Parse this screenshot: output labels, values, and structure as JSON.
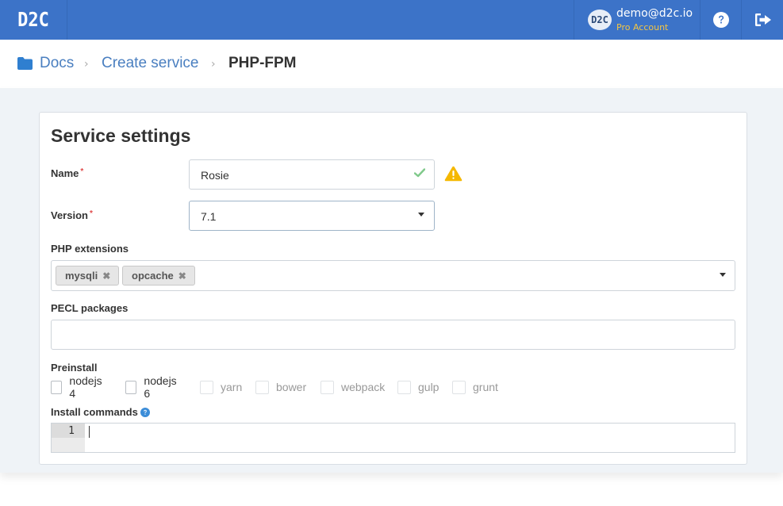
{
  "app": {
    "logo_text": "D2C",
    "account": {
      "avatar_text": "D2C",
      "email": "demo@d2c.io",
      "plan": "Pro Account"
    },
    "icons": {
      "help": "question-circle-icon",
      "logout": "sign-out-icon"
    }
  },
  "breadcrumb": {
    "items": [
      "Docs",
      "Create service"
    ],
    "current": "PHP-FPM",
    "separator": "›"
  },
  "form": {
    "title": "Service settings",
    "name": {
      "label": "Name",
      "required_mark": "*",
      "value": "Rosie"
    },
    "version": {
      "label": "Version",
      "required_mark": "*",
      "selected": "7.1"
    },
    "php_extensions": {
      "label": "PHP extensions",
      "tags": [
        "mysqli",
        "opcache"
      ],
      "remove_mark": "✖"
    },
    "pecl_packages": {
      "label": "PECL packages",
      "value": ""
    },
    "preinstall": {
      "label": "Preinstall",
      "options": [
        {
          "label": "nodejs 4",
          "checked": false,
          "enabled": true
        },
        {
          "label": "nodejs 6",
          "checked": false,
          "enabled": true
        },
        {
          "label": "yarn",
          "checked": false,
          "enabled": false
        },
        {
          "label": "bower",
          "checked": false,
          "enabled": false
        },
        {
          "label": "webpack",
          "checked": false,
          "enabled": false
        },
        {
          "label": "gulp",
          "checked": false,
          "enabled": false
        },
        {
          "label": "grunt",
          "checked": false,
          "enabled": false
        }
      ]
    },
    "install_commands": {
      "label": "Install commands",
      "line_number": "1",
      "value": ""
    }
  },
  "colors": {
    "topbar": "#3c73c8",
    "link": "#4a7fc0",
    "warning": "#f5b800",
    "success": "#5cb85c",
    "plan": "#f4c542",
    "info": "#3c8dd8"
  }
}
